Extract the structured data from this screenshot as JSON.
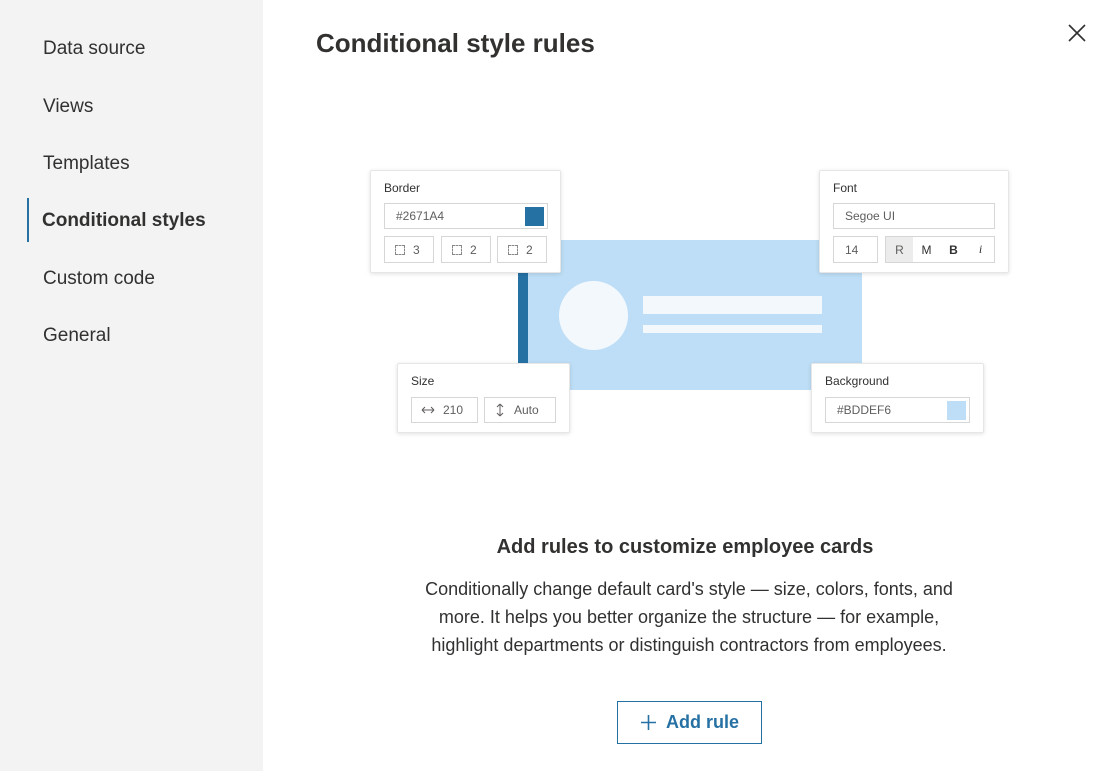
{
  "sidebar": {
    "items": [
      {
        "label": "Data source",
        "active": false
      },
      {
        "label": "Views",
        "active": false
      },
      {
        "label": "Templates",
        "active": false
      },
      {
        "label": "Conditional styles",
        "active": true
      },
      {
        "label": "Custom code",
        "active": false
      },
      {
        "label": "General",
        "active": false
      }
    ]
  },
  "header": {
    "title": "Conditional style rules",
    "close_icon": "close-icon"
  },
  "illustration": {
    "border_panel": {
      "label": "Border",
      "color_value": "#2671A4",
      "swatch_color": "#2671a4",
      "width_values": [
        "3",
        "2",
        "2"
      ]
    },
    "font_panel": {
      "label": "Font",
      "font_name": "Segoe UI",
      "font_size": "14",
      "weights": [
        "R",
        "M",
        "B",
        "i"
      ]
    },
    "size_panel": {
      "label": "Size",
      "width_value": "210",
      "height_value": "Auto"
    },
    "background_panel": {
      "label": "Background",
      "color_value": "#BDDEF6",
      "swatch_color": "#bddef6"
    }
  },
  "empty_state": {
    "heading": "Add rules to customize employee cards",
    "description": "Conditionally change default card's style — size, colors, fonts, and more. It helps you better organize the structure — for example, highlight departments or distinguish contractors from employees."
  },
  "actions": {
    "add_rule_label": "Add rule",
    "add_icon": "plus-icon"
  },
  "colors": {
    "accent": "#2671a4",
    "sidebar_bg": "#f3f3f3",
    "card_bg": "#bddef6"
  }
}
